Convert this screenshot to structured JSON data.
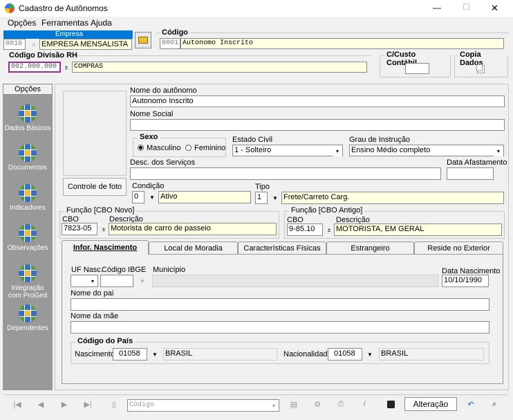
{
  "window": {
    "title": "Cadastro de Autônomos",
    "minimize": "—",
    "maximize": "☐",
    "close": "✕"
  },
  "menu": [
    "Opções",
    "Ferramentas",
    "Ajuda"
  ],
  "empresa": {
    "label": "Empresa",
    "code": "0010",
    "name": "EMPRESA MENSALISTA"
  },
  "codigo": {
    "label": "Código",
    "code": "0001",
    "name": "Autonomo  Inscrito"
  },
  "divisao": {
    "label": "Código Divisão RH",
    "code": "002.000.000",
    "name": "COMPRAS"
  },
  "custo": {
    "label": "C/Custo Contábil"
  },
  "copia": {
    "label": "Copia Dados"
  },
  "sidebar": {
    "header": "Opções",
    "items": [
      "Dados Básicos",
      "Documentos",
      "Indicadores",
      "Observações",
      "Integração com ProGed",
      "Dependentes"
    ]
  },
  "photo_button": "Controle de foto",
  "form": {
    "nome_label": "Nome do autônomo",
    "nome_value": "Autonomo Inscrito",
    "social_label": "Nome Social",
    "social_value": "",
    "sexo_label": "Sexo",
    "sexo_options": [
      "Masculino",
      "Feminino"
    ],
    "sexo_selected": "Masculino",
    "estado_label": "Estado Civil",
    "estado_value": "1 - Solteiro",
    "grau_label": "Grau de Instrução",
    "grau_value": "Ensino Médio completo",
    "desc_label": "Desc. dos Serviços",
    "desc_value": "",
    "afast_label": "Data Afastamento",
    "afast_value": "",
    "condicao_label": "Condição",
    "condicao_code": "0",
    "condicao_value": "Ativo",
    "tipo_label": "Tipo",
    "tipo_code": "1",
    "tipo_value": "Frete/Carreto Carg."
  },
  "cbo_novo": {
    "label": "Função [CBO Novo]",
    "cbo_label": "CBO",
    "desc_label": "Descrição",
    "cbo": "7823-05",
    "desc": "Motorista de carro de passeio"
  },
  "cbo_antigo": {
    "label": "Função [CBO Antigo]",
    "cbo_label": "CBO",
    "desc_label": "Descrição",
    "cbo": "9-85.10",
    "desc": "MOTORISTA, EM GERAL"
  },
  "tabs": [
    "Infor. Nascimento",
    "Local de Moradia",
    "Características Físicas",
    "Estrangeiro",
    "Reside no Exterior"
  ],
  "active_tab": "Infor. Nascimento",
  "nascimento": {
    "uf_label": "UF Nasc.",
    "ibge_label": "Código IBGE",
    "municipio_label": "Município",
    "data_label": "Data Nascimento",
    "data_value": "10/10/1990",
    "pai_label": "Nome do pai",
    "mae_label": "Nome da mãe",
    "pais_label": "Código do País",
    "nasc_label": "Nascimento",
    "nasc_code": "01058",
    "nasc_name": "BRASIL",
    "nac_label": "Nacionalidade",
    "nac_code": "01058",
    "nac_name": "BRASIL"
  },
  "footer": {
    "codigo_placeholder": "Código",
    "status": "Alteração"
  }
}
